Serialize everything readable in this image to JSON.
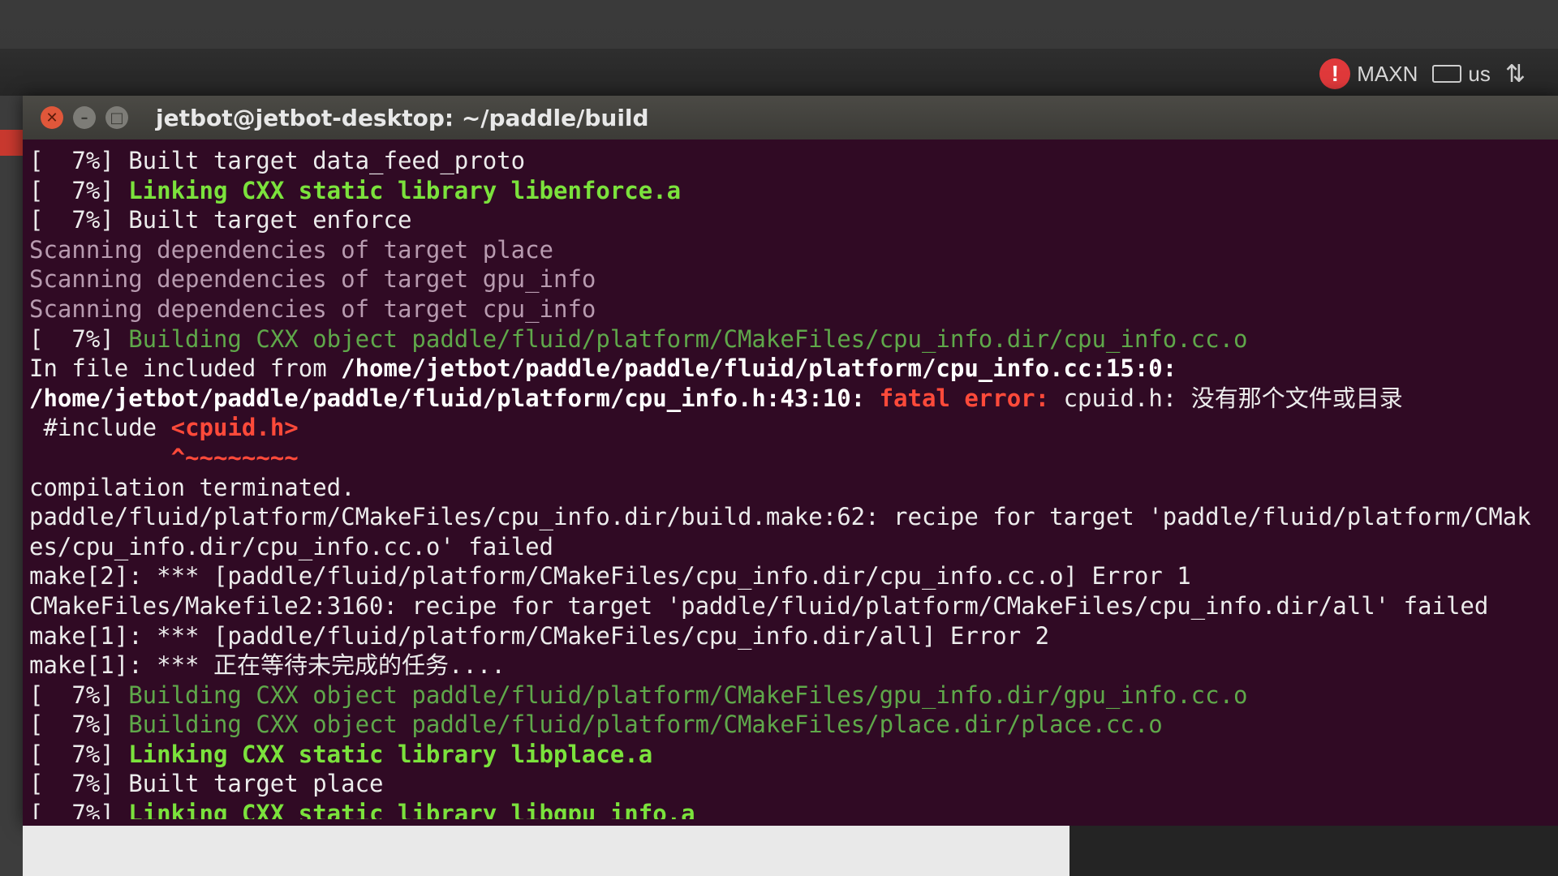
{
  "indicators": {
    "power_mode": "MAXN",
    "keyboard_layout": "us",
    "warning_icon": "warning-icon",
    "network_icon": "network-updown-icon"
  },
  "window": {
    "title": "jetbot@jetbot-desktop: ~/paddle/build",
    "buttons": [
      "close",
      "minimize",
      "maximize"
    ]
  },
  "terminal": {
    "lines": [
      [
        {
          "t": "[  7%] Built target data_feed_proto",
          "c": "white"
        }
      ],
      [
        {
          "t": "[  7%] ",
          "c": "white"
        },
        {
          "t": "Linking CXX static library libenforce.a",
          "c": "green"
        }
      ],
      [
        {
          "t": "[  7%] Built target enforce",
          "c": "white"
        }
      ],
      [
        {
          "t": "Scanning dependencies of target place",
          "c": "scan"
        }
      ],
      [
        {
          "t": "Scanning dependencies of target gpu_info",
          "c": "scan"
        }
      ],
      [
        {
          "t": "Scanning dependencies of target cpu_info",
          "c": "scan"
        }
      ],
      [
        {
          "t": "[  7%] ",
          "c": "white"
        },
        {
          "t": "Building CXX object paddle/fluid/platform/CMakeFiles/cpu_info.dir/cpu_info.cc.o",
          "c": "dimgreen"
        }
      ],
      [
        {
          "t": "In file included from ",
          "c": "white"
        },
        {
          "t": "/home/jetbot/paddle/paddle/fluid/platform/cpu_info.cc:15:0:",
          "c": "bold"
        }
      ],
      [
        {
          "t": "/home/jetbot/paddle/paddle/fluid/platform/cpu_info.h:43:10: ",
          "c": "bold"
        },
        {
          "t": "fatal error: ",
          "c": "red"
        },
        {
          "t": "cpuid.h: 没有那个文件或目录",
          "c": "white"
        }
      ],
      [
        {
          "t": " #include ",
          "c": "white"
        },
        {
          "t": "<cpuid.h>",
          "c": "red"
        }
      ],
      [
        {
          "t": "          ^~~~~~~~~",
          "c": "red"
        }
      ],
      [
        {
          "t": "compilation terminated.",
          "c": "white"
        }
      ],
      [
        {
          "t": "paddle/fluid/platform/CMakeFiles/cpu_info.dir/build.make:62: recipe for target 'paddle/fluid/platform/CMak",
          "c": "white"
        }
      ],
      [
        {
          "t": "es/cpu_info.dir/cpu_info.cc.o' failed",
          "c": "white"
        }
      ],
      [
        {
          "t": "make[2]: *** [paddle/fluid/platform/CMakeFiles/cpu_info.dir/cpu_info.cc.o] Error 1",
          "c": "white"
        }
      ],
      [
        {
          "t": "CMakeFiles/Makefile2:3160: recipe for target 'paddle/fluid/platform/CMakeFiles/cpu_info.dir/all' failed",
          "c": "white"
        }
      ],
      [
        {
          "t": "make[1]: *** [paddle/fluid/platform/CMakeFiles/cpu_info.dir/all] Error 2",
          "c": "white"
        }
      ],
      [
        {
          "t": "make[1]: *** 正在等待未完成的任务....",
          "c": "white"
        }
      ],
      [
        {
          "t": "[  7%] ",
          "c": "white"
        },
        {
          "t": "Building CXX object paddle/fluid/platform/CMakeFiles/gpu_info.dir/gpu_info.cc.o",
          "c": "dimgreen"
        }
      ],
      [
        {
          "t": "[  7%] ",
          "c": "white"
        },
        {
          "t": "Building CXX object paddle/fluid/platform/CMakeFiles/place.dir/place.cc.o",
          "c": "dimgreen"
        }
      ],
      [
        {
          "t": "[  7%] ",
          "c": "white"
        },
        {
          "t": "Linking CXX static library libplace.a",
          "c": "green"
        }
      ],
      [
        {
          "t": "[  7%] Built target place",
          "c": "white"
        }
      ],
      [
        {
          "t": "[  7%] ",
          "c": "white"
        },
        {
          "t": "Linking CXX static library libgpu_info.a",
          "c": "green"
        }
      ]
    ]
  },
  "colors": {
    "terminal_bg": "#300a24",
    "green": "#7be23c",
    "dim_green": "#5fa84a",
    "error_red": "#ff4a3a",
    "close_button": "#e0573a"
  }
}
